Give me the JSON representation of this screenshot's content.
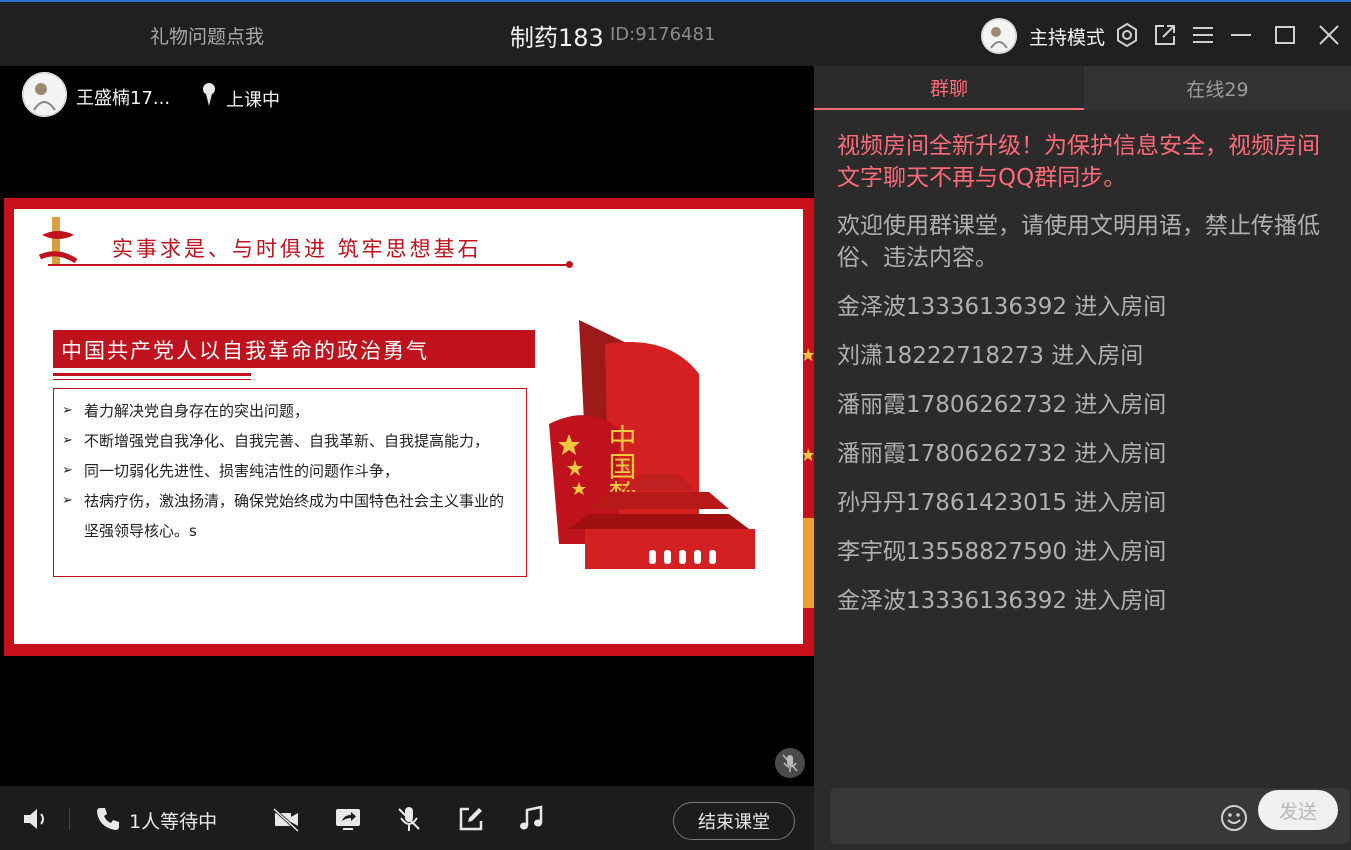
{
  "titlebar": {
    "gift_link": "礼物问题点我",
    "room_title": "制药183",
    "room_id": "ID:9176481",
    "host_mode": "主持模式"
  },
  "video": {
    "teacher_name": "王盛楠17...",
    "class_status": "上课中"
  },
  "slide": {
    "heading": "实事求是、与时俱进  筑牢思想基石",
    "subtitle": "中国共产党人以自我革命的政治勇气",
    "bullets": [
      "着力解决党自身存在的突出问题，",
      "不断增强党自我净化、自我完善、自我革新、自我提高能力，",
      "同一切弱化先进性、损害纯洁性的问题作斗争，",
      "祛病疗伤，激浊扬清，确保党始终成为中国特色社会主义事业的坚强领导核心。s"
    ],
    "deco_text": "中国梦"
  },
  "toolbar": {
    "waiting": "1人等待中",
    "end_class": "结束课堂"
  },
  "chat": {
    "tab_group": "群聊",
    "tab_online": "在线29",
    "notice": "视频房间全新升级！为保护信息安全，视频房间文字聊天不再与QQ群同步。",
    "welcome": "欢迎使用群课堂，请使用文明用语，禁止传播低俗、违法内容。",
    "joins": [
      "金泽波13336136392 进入房间",
      "刘潇18222718273 进入房间",
      "潘丽霞17806262732 进入房间",
      "潘丽霞17806262732 进入房间",
      "孙丹丹17861423015 进入房间",
      "李宇砚13558827590 进入房间",
      "金泽波13336136392 进入房间"
    ],
    "input_placeholder": "",
    "send": "发送"
  },
  "colors": {
    "accent_pink": "#ff6a78",
    "slide_red": "#c0121c",
    "title_bar_border": "#2f6fd0"
  },
  "icons": [
    "avatar-icon",
    "settings-icon",
    "popout-icon",
    "menu-icon",
    "minimize-icon",
    "maximize-icon",
    "close-icon",
    "speaker-icon",
    "phone-icon",
    "camera-off-icon",
    "screen-share-icon",
    "microphone-icon",
    "whiteboard-icon",
    "music-icon",
    "emoji-icon",
    "mute-icon"
  ]
}
